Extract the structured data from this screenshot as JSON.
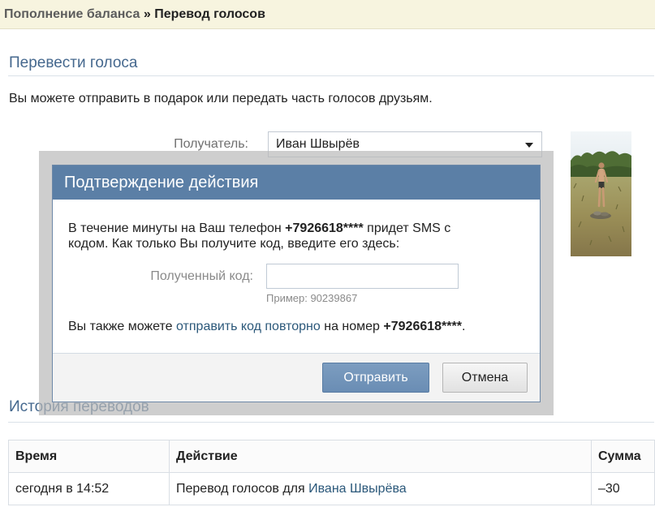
{
  "breadcrumb": {
    "parent": "Пополнение баланса",
    "separator": "»",
    "current": "Перевод голосов"
  },
  "transfer": {
    "title": "Перевести голоса",
    "description": "Вы можете отправить в подарок или передать часть голосов друзьям.",
    "recipient_label": "Получатель:",
    "recipient_value": "Иван Швырёв"
  },
  "dialog": {
    "title": "Подтверждение действия",
    "intro_before": "В течение минуты на Ваш телефон",
    "phone": "+7926618****",
    "intro_after": "придет SMS с",
    "intro_line2": "кодом. Как только Вы получите код, введите его здесь:",
    "code_label": "Полученный код:",
    "code_value": "",
    "code_example": "Пример: 90239867",
    "resend_before": "Вы также можете",
    "resend_link": "отправить код повторно",
    "resend_middle": "на номер",
    "resend_phone": "+7926618****",
    "resend_end": ".",
    "submit_label": "Отправить",
    "cancel_label": "Отмена"
  },
  "history": {
    "title": "История переводов",
    "columns": [
      "Время",
      "Действие",
      "Сумма"
    ],
    "rows": [
      {
        "time": "сегодня в 14:52",
        "action_text": "Перевод голосов для",
        "action_link": "Ивана Швырёва",
        "amount": "–30"
      }
    ]
  },
  "icons": {
    "recipient_dropdown": "chevron-down-icon"
  },
  "colors": {
    "accent": "#45688e",
    "link": "#2b587a",
    "dialog_header": "#5b7fa6",
    "button_primary": "#6a8db4",
    "crumb_bg": "#f7f4df",
    "line": "#dae1e8"
  }
}
